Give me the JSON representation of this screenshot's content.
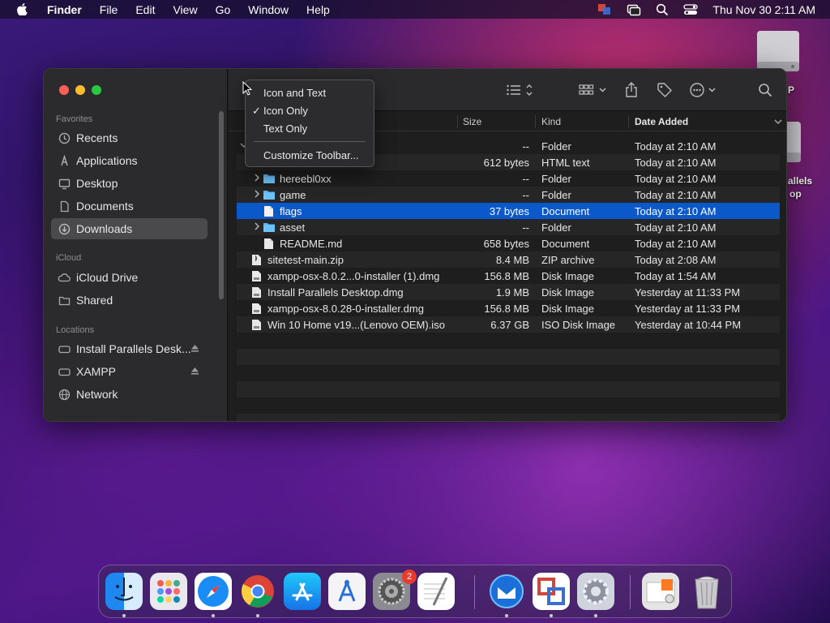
{
  "menubar": {
    "app": "Finder",
    "items": [
      "File",
      "Edit",
      "View",
      "Go",
      "Window",
      "Help"
    ],
    "clock": "Thu Nov 30  2:11 AM"
  },
  "desktop": {
    "labels": [
      "P",
      "allels",
      "op"
    ]
  },
  "sidebar": {
    "favorites_header": "Favorites",
    "favorites": [
      "Recents",
      "Applications",
      "Desktop",
      "Documents",
      "Downloads"
    ],
    "icloud_header": "iCloud",
    "icloud": [
      "iCloud Drive",
      "Shared"
    ],
    "locations_header": "Locations",
    "locations": [
      "Install Parallels Desk...",
      "XAMPP",
      "Network"
    ]
  },
  "columns": {
    "size": "Size",
    "kind": "Kind",
    "date": "Date Added"
  },
  "rows": [
    {
      "name": "",
      "size": "--",
      "kind": "Folder",
      "date": "Today at 2:10 AM"
    },
    {
      "name": "",
      "size": "612 bytes",
      "kind": "HTML text",
      "date": "Today at 2:10 AM"
    },
    {
      "name": "hereebl0xx",
      "size": "--",
      "kind": "Folder",
      "date": "Today at 2:10 AM"
    },
    {
      "name": "game",
      "size": "--",
      "kind": "Folder",
      "date": "Today at 2:10 AM"
    },
    {
      "name": "flags",
      "size": "37 bytes",
      "kind": "Document",
      "date": "Today at 2:10 AM"
    },
    {
      "name": "asset",
      "size": "--",
      "kind": "Folder",
      "date": "Today at 2:10 AM"
    },
    {
      "name": "README.md",
      "size": "658 bytes",
      "kind": "Document",
      "date": "Today at 2:10 AM"
    },
    {
      "name": "sitetest-main.zip",
      "size": "8.4 MB",
      "kind": "ZIP archive",
      "date": "Today at 2:08 AM"
    },
    {
      "name": "xampp-osx-8.0.2...0-installer (1).dmg",
      "size": "156.8 MB",
      "kind": "Disk Image",
      "date": "Today at 1:54 AM"
    },
    {
      "name": "Install Parallels Desktop.dmg",
      "size": "1.9 MB",
      "kind": "Disk Image",
      "date": "Yesterday at 11:33 PM"
    },
    {
      "name": "xampp-osx-8.0.28-0-installer.dmg",
      "size": "156.8 MB",
      "kind": "Disk Image",
      "date": "Yesterday at 11:33 PM"
    },
    {
      "name": "Win 10 Home v19...(Lenovo OEM).iso",
      "size": "6.37 GB",
      "kind": "ISO Disk Image",
      "date": "Yesterday at 10:44 PM"
    }
  ],
  "context_menu": {
    "items": [
      "Icon and Text",
      "Icon Only",
      "Text Only",
      "Customize Toolbar..."
    ],
    "checked": "Icon Only",
    "check_mark": "✓"
  },
  "dock": {
    "badge": "2"
  },
  "colors": {
    "selection": "#0a58ca",
    "folder": "#5bb5f5",
    "close": "#ff5f57",
    "minimize": "#febc2e",
    "zoom": "#28c840"
  }
}
